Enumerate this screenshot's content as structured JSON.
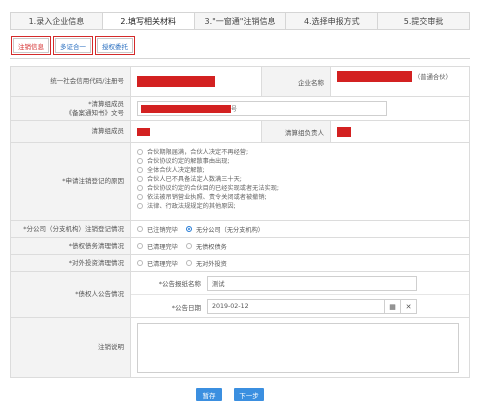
{
  "steps": [
    "1.录入企业信息",
    "2.填写相关材料",
    "3.\"一窗通\"注销信息",
    "4.选择申报方式",
    "5.提交审批"
  ],
  "subtabs": [
    "注销信息",
    "多证合一",
    "授权委托"
  ],
  "fields": {
    "credit_code_label": "统一社会信用代码/注册号",
    "company_name_label": "企业名称",
    "company_name_suffix": "（普通合伙）",
    "liquidation_doc_label_line1": "*清算组成员",
    "liquidation_doc_label_line2": "《备案通知书》文号",
    "liquidation_doc_tail": "号",
    "members_label": "清算组成员",
    "leader_label": "清算组负责人",
    "reason_label": "*申请注销登记的原因",
    "reasons": [
      "合伙期限届满，合伙人决定不再经营;",
      "合伙协议约定的解散事由出现;",
      "全体合伙人决定解散;",
      "合伙人已不具备法定人数满三十天;",
      "合伙协议约定的合伙目的已经实现或者无法实现;",
      "依法被吊销营业执照、责令关闭或者被撤销;",
      "法律、行政法规规定的其他原因;"
    ],
    "branch_label": "*分公司（分支机构）注销登记情况",
    "branch_opt1": "已注销完毕",
    "branch_opt2": "无分公司（无分支机构）",
    "debt_label": "*债权债务清理情况",
    "debt_opt1": "已清理完毕",
    "debt_opt2": "无债权债务",
    "invest_label": "*对外投资清理情况",
    "invest_opt1": "已清理完毕",
    "invest_opt2": "无对外投资",
    "creditor_label": "*债权人公告情况",
    "notice_name_label": "*公告报纸名称",
    "notice_name_value": "测试",
    "notice_date_label": "*公告日期",
    "notice_date_value": "2019-02-12",
    "remark_label": "注销说明"
  },
  "buttons": {
    "save": "暂存",
    "next": "下一步"
  },
  "colors": {
    "accent": "#3b8fe0",
    "highlight": "#d42a2a",
    "redaction": "#d32121"
  }
}
